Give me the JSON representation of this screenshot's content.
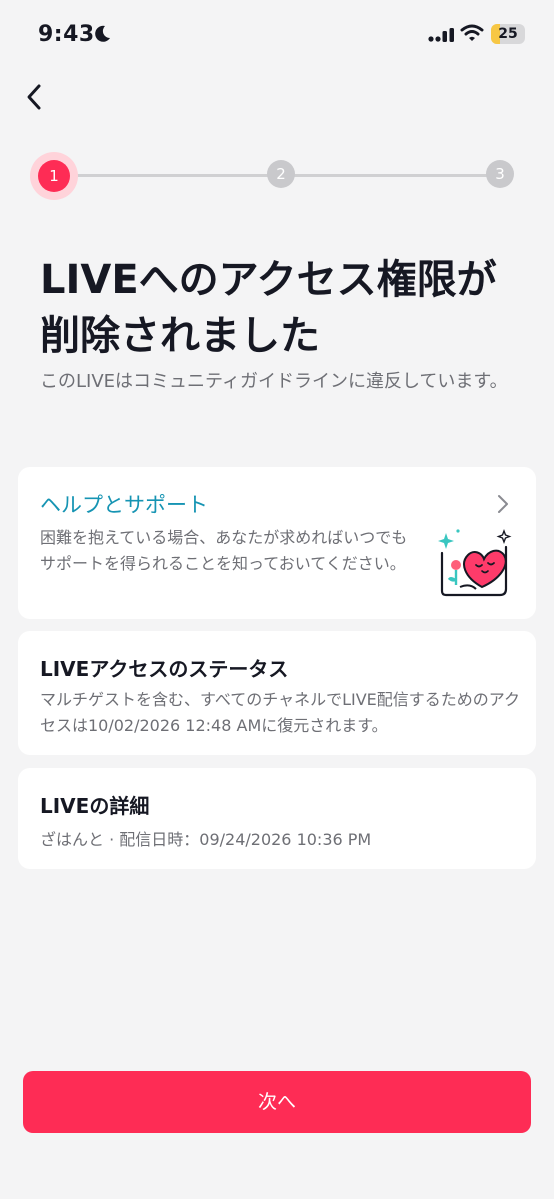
{
  "status_bar": {
    "time": "9:43",
    "battery_level": "25",
    "battery_fraction": 0.25,
    "icons": [
      "moon-icon",
      "signal-icon",
      "wifi-icon",
      "battery-icon"
    ]
  },
  "nav": {
    "back_icon": "chevron-left-icon"
  },
  "stepper": {
    "steps": [
      "1",
      "2",
      "3"
    ],
    "active_step": 1,
    "active_color": "#fe2c55",
    "inactive_color": "#c9c9cc"
  },
  "header": {
    "title_line1": "LIVEへのアクセス権限が",
    "title_line2": "削除されました",
    "subtitle": "このLIVEはコミュニティガイドラインに違反しています。"
  },
  "help_card": {
    "title": "ヘルプとサポート",
    "description": "困難を抱えている場合、あなたが求めればいつでもサポートを得られることを知っておいてください。",
    "title_color": "#1694b3",
    "chevron_icon": "chevron-right-icon",
    "illustration": "heart-hug-illustration"
  },
  "status_card": {
    "title": "LIVEアクセスのステータス",
    "description": "マルチゲストを含む、すべてのチャネルでLIVE配信するためのアクセスは10/02/2026 12:48 AMに復元されます。"
  },
  "details_card": {
    "title": "LIVEの詳細",
    "meta": "ざはんと · 配信日時：09/24/2026 10:36 PM"
  },
  "footer": {
    "next_label": "次へ",
    "button_color": "#fe2c55"
  }
}
